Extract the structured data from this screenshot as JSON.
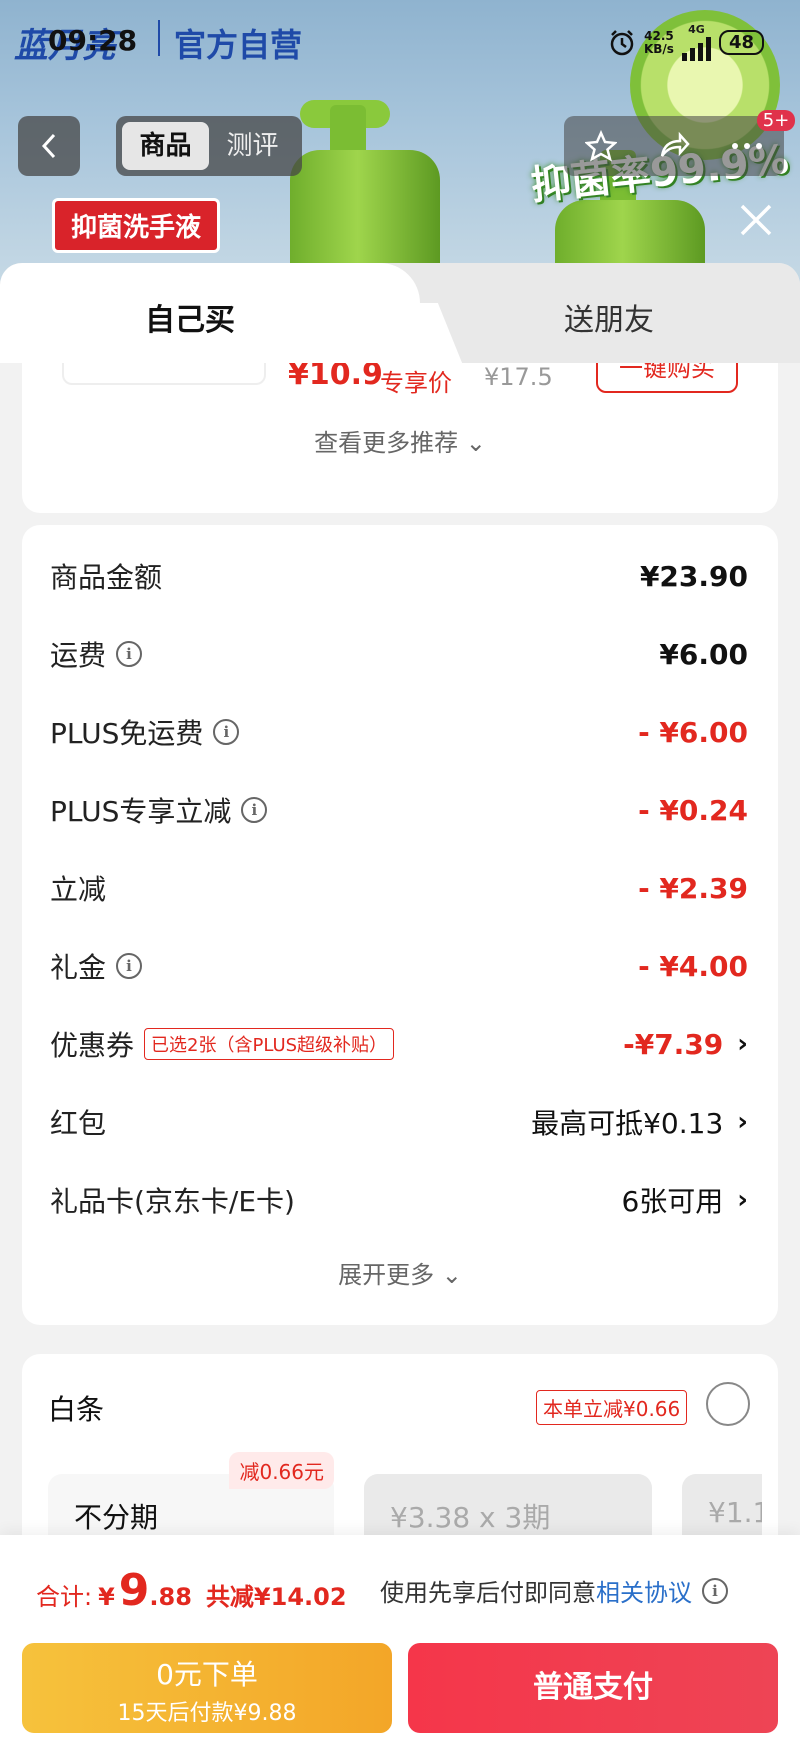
{
  "status_bar": {
    "time": "09:28",
    "net_speed": "42.5",
    "net_unit": "KB/s",
    "network": "4G",
    "battery": "48"
  },
  "banner": {
    "brand": "蓝月亮",
    "official_store": "官方自营",
    "product_tag": "抑菌洗手液",
    "slogan": "抑菌率99.9%"
  },
  "nav": {
    "tabs": [
      {
        "label": "商品",
        "active": true
      },
      {
        "label": "测评",
        "active": false
      }
    ],
    "message_badge": "5+"
  },
  "sheet": {
    "tabs": [
      {
        "label": "自己买",
        "active": true
      },
      {
        "label": "送朋友",
        "active": false
      }
    ]
  },
  "recommend": {
    "price": "¥10.9",
    "price_tag": "专享价",
    "original_price": "¥17.5",
    "buy_label": "一键购买",
    "more_label": "查看更多推荐"
  },
  "price_detail": {
    "rows": [
      {
        "label": "商品金额",
        "value": "¥23.90"
      },
      {
        "label": "运费",
        "value": "¥6.00"
      },
      {
        "label": "PLUS免运费",
        "value": "- ¥6.00"
      },
      {
        "label": "PLUS专享立减",
        "value": "- ¥0.24"
      },
      {
        "label": "立减",
        "value": "- ¥2.39"
      },
      {
        "label": "礼金",
        "value": "- ¥4.00"
      },
      {
        "label": "优惠券",
        "value": "-¥7.39",
        "tag": "已选2张（含PLUS超级补贴）"
      },
      {
        "label": "红包",
        "value": "最高可抵¥0.13"
      },
      {
        "label": "礼品卡(京东卡/E卡)",
        "value": "6张可用"
      }
    ],
    "expand_label": "展开更多"
  },
  "baitiao": {
    "title": "白条",
    "promo": "本单立减¥0.66",
    "plans": [
      {
        "label": "不分期",
        "badge": "减0.66元"
      },
      {
        "label": "¥3.38 x 3期"
      },
      {
        "label": "¥1.1"
      }
    ]
  },
  "footer": {
    "total_label": "合计:",
    "currency": "¥",
    "total_int": "9",
    "total_dec": ".88",
    "total_cut": "共减¥14.02",
    "agree_text": "使用先享后付即同意",
    "agree_link": "相关协议",
    "later_line1": "0元下单",
    "later_line2": "15天后付款¥9.88",
    "pay_label": "普通支付"
  },
  "colors": {
    "accent_red": "#e2281f",
    "pay_red": "#f5364a",
    "later_yellow": "#f6c23c",
    "link_blue": "#2a6fc9"
  }
}
